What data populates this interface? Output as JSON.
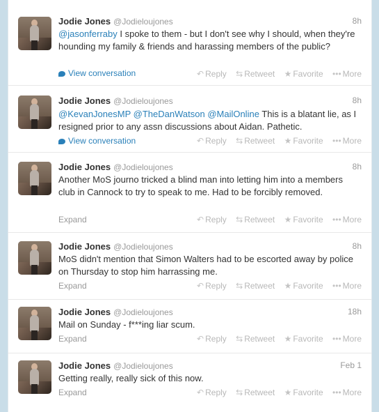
{
  "tweets": [
    {
      "name": "Jodie Jones",
      "handle": "@Jodieloujones",
      "time": "8h",
      "mention": "@jasonferraby",
      "text_part": " I spoke to them - but I don't see why I should, when they're hounding my family & friends and harassing members of the public?",
      "footer": "View conversation"
    },
    {
      "name": "Jodie Jones",
      "handle": "@Jodieloujones",
      "time": "8h",
      "mention1": "@KevanJonesMP",
      "mention2": "@TheDanWatson",
      "mention3": "@MailOnline",
      "text_part": " This is a blatant lie, as I resigned prior to any assn discussions about Aidan. Pathetic.",
      "footer": "View conversation"
    },
    {
      "name": "Jodie Jones",
      "handle": "@Jodieloujones",
      "time": "8h",
      "text": "Another MoS journo tricked a blind man into letting him into a members club in Cannock to try to speak to me. Had to be forcibly removed.",
      "footer": "Expand"
    },
    {
      "name": "Jodie Jones",
      "handle": "@Jodieloujones",
      "time": "8h",
      "text": "MoS didn't mention that Simon Walters had to be escorted away by police on Thursday to stop him harrassing me.",
      "footer": "Expand"
    },
    {
      "name": "Jodie Jones",
      "handle": "@Jodieloujones",
      "time": "18h",
      "text": "Mail on Sunday - f***ing liar scum.",
      "footer": "Expand"
    },
    {
      "name": "Jodie Jones",
      "handle": "@Jodieloujones",
      "time": "Feb 1",
      "text": "Getting really, really sick of this now.",
      "footer": "Expand"
    }
  ],
  "actions": {
    "reply": "Reply",
    "retweet": "Retweet",
    "favorite": "Favorite",
    "more": "More"
  },
  "icons": {
    "reply": "reply-arrow-icon",
    "retweet": "retweet-icon",
    "favorite": "star-icon",
    "more": "ellipsis-icon",
    "conversation": "speech-bubble-icon"
  },
  "colors": {
    "link": "#2a80b9",
    "name": "#333333",
    "muted": "#999999",
    "background": "#c9dde8"
  }
}
